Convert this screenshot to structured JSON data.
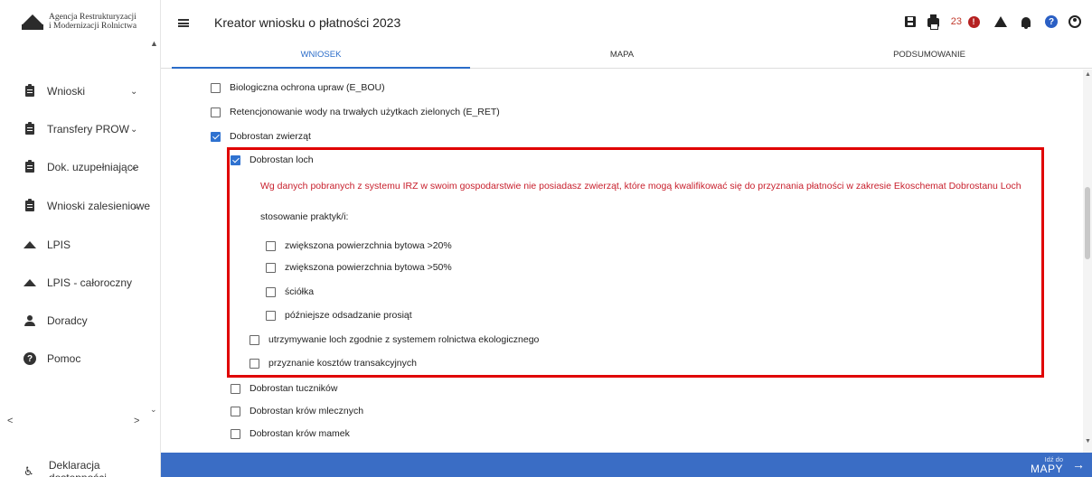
{
  "sidebar": {
    "logo_line1": "Agencja Restrukturyzacji",
    "logo_line2": "i Modernizacji Rolnictwa",
    "items": [
      {
        "label": "Wnioski",
        "icon": "clipboard-icon",
        "has_chevron": true
      },
      {
        "label": "Transfery PROW",
        "icon": "clipboard-icon",
        "has_chevron": true
      },
      {
        "label": "Dok. uzupełniające",
        "icon": "clipboard-icon",
        "has_chevron": true
      },
      {
        "label": "Wnioski zalesieniowe",
        "icon": "clipboard-icon",
        "has_chevron": true
      },
      {
        "label": "LPIS",
        "icon": "mountain-icon",
        "has_chevron": false
      },
      {
        "label": "LPIS - całoroczny",
        "icon": "mountain-icon",
        "has_chevron": false
      },
      {
        "label": "Doradcy",
        "icon": "person-icon",
        "has_chevron": false
      },
      {
        "label": "Pomoc",
        "icon": "help-icon",
        "has_chevron": false
      }
    ],
    "accessibility_label": "Deklaracja dostępności"
  },
  "header": {
    "title": "Kreator wniosku o płatności 2023",
    "error_count": "23",
    "tabs": [
      "WNIOSEK",
      "MAPA",
      "PODSUMOWANIE"
    ],
    "active_tab": "WNIOSEK"
  },
  "content": {
    "items_top": [
      {
        "label": "Biologiczna ochrona upraw (E_BOU)",
        "checked": false
      },
      {
        "label": "Retencjonowanie wody na trwałych użytkach zielonych (E_RET)",
        "checked": false
      },
      {
        "label": "Dobrostan zwierząt",
        "checked": true
      }
    ],
    "sub_item": {
      "label": "Dobrostan loch",
      "checked": true
    },
    "warning": "Wg danych pobranych z systemu IRZ w swoim gospodarstwie nie posiadasz zwierząt, które mogą kwalifikować się do przyznania płatności w zakresie Ekoschemat Dobrostanu Loch",
    "practices_label": "stosowanie praktyk/i:",
    "practices": [
      {
        "label": "zwiększona powierzchnia bytowa >20%",
        "checked": false
      },
      {
        "label": "zwiększona powierzchnia bytowa >50%",
        "checked": false
      },
      {
        "label": "ściółka",
        "checked": false
      },
      {
        "label": "późniejsze odsadzanie prosiąt",
        "checked": false
      }
    ],
    "options": [
      {
        "label": "utrzymywanie loch zgodnie z systemem rolnictwa ekologicznego",
        "checked": false
      },
      {
        "label": "przyznanie kosztów transakcyjnych",
        "checked": false
      }
    ],
    "items_bottom": [
      {
        "label": "Dobrostan tuczników",
        "checked": false
      },
      {
        "label": "Dobrostan krów mlecznych",
        "checked": false
      },
      {
        "label": "Dobrostan krów mamek",
        "checked": false
      }
    ]
  },
  "footer": {
    "goto_small": "Idź do",
    "goto_big": "MAPY"
  }
}
